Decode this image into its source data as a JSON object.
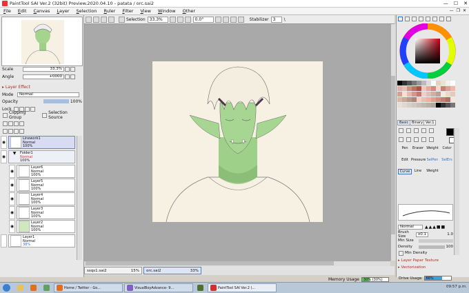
{
  "window": {
    "title": "PaintTool SAI Ver.2 (32bit) Preview.2020.04.10 - patata / orc.sai2"
  },
  "menu": [
    {
      "key": "F",
      "rest": "ile"
    },
    {
      "key": "E",
      "rest": "dit"
    },
    {
      "key": "C",
      "rest": "anvas"
    },
    {
      "key": "L",
      "rest": "ayer"
    },
    {
      "key": "S",
      "rest": "election"
    },
    {
      "key": "R",
      "rest": "uler"
    },
    {
      "key": "F",
      "rest": "ilter"
    },
    {
      "key": "V",
      "rest": "iew"
    },
    {
      "key": "W",
      "rest": "indow"
    },
    {
      "key": "O",
      "rest": "ther"
    }
  ],
  "navigator": {
    "scale_label": "Scale",
    "scale_value": "33.3%",
    "angle_label": "Angle",
    "angle_value": "+0000"
  },
  "layer_effect": {
    "header": "Layer Effect",
    "mode_label": "Mode",
    "mode_value": "Normal",
    "opacity_label": "Opacity",
    "opacity_value": "100%",
    "lock_label": "Lock",
    "clip_label": "Clipping Group",
    "selsrc_label": "Selection Source"
  },
  "layers": [
    {
      "name": "Linework1",
      "mode": "Normal",
      "opacity": "100%"
    },
    {
      "name": "Folder1",
      "mode": "Normal",
      "opacity": "100%"
    },
    {
      "name": "Layer6",
      "mode": "Normal",
      "opacity": "100%"
    },
    {
      "name": "Layer5",
      "mode": "Normal",
      "opacity": "100%"
    },
    {
      "name": "Layer4",
      "mode": "Normal",
      "opacity": "100%"
    },
    {
      "name": "Layer3",
      "mode": "Normal",
      "opacity": "100%"
    },
    {
      "name": "Layer2",
      "mode": "Normal",
      "opacity": "100%"
    },
    {
      "name": "Layer1",
      "mode": "Normal",
      "opacity": "38%"
    }
  ],
  "canvas_toolbar": {
    "selection_label": "Selection",
    "zoom": "33.3%",
    "rotation": "0.0°",
    "stabilizer_label": "Stabilizer",
    "stabilizer_value": "3"
  },
  "file_tabs": [
    {
      "name": "ssqs1.sai2",
      "zoom": "15%"
    },
    {
      "name": "orc.sai2",
      "zoom": "33%"
    }
  ],
  "memory": {
    "label": "Memory Usage",
    "value": "30% (30%)",
    "fraction": 0.3
  },
  "drive": {
    "label": "Drive Usage",
    "value": "66%",
    "fraction": 0.66
  },
  "tool_tabs": [
    "Basic",
    "Binary",
    "Ver.1"
  ],
  "tool_groups": [
    {
      "title": "Pen",
      "sub": ""
    },
    {
      "title": "Eraser",
      "sub": ""
    },
    {
      "title": "Weight",
      "sub": ""
    },
    {
      "title": "Color",
      "sub": ""
    },
    {
      "title": "Edit",
      "sub": ""
    },
    {
      "title": "Pressure",
      "sub": ""
    },
    {
      "title": "SelPen",
      "sub": ""
    },
    {
      "title": "SelErs",
      "sub": ""
    },
    {
      "title": "Curve",
      "sub": ""
    },
    {
      "title": "Line",
      "sub": ""
    },
    {
      "title": "Weight",
      "sub": ""
    }
  ],
  "brush": {
    "mode": "Normal",
    "size_label": "Brush Size",
    "size_mult": "x0.1",
    "size_value": "1.0",
    "min_size_label": "Min Size",
    "density_label": "Density",
    "density_value": "100",
    "min_density_label": "Min Density",
    "paper_label": "Layer Paper Texture",
    "vector_label": "Vectorization"
  },
  "taskbar": {
    "items": [
      "Home / Twitter - Go...",
      "VisualBoyAdvance- 9...",
      "PaintTool SAI Ver.2 (..."
    ],
    "time": "09:57 p.m."
  },
  "colors": {
    "accent": "#3a6fc4",
    "section_red": "#b03020",
    "canvas_gray": "#a9a9a9",
    "paper": "#f7f1e3",
    "skin": "#9fd08a"
  }
}
